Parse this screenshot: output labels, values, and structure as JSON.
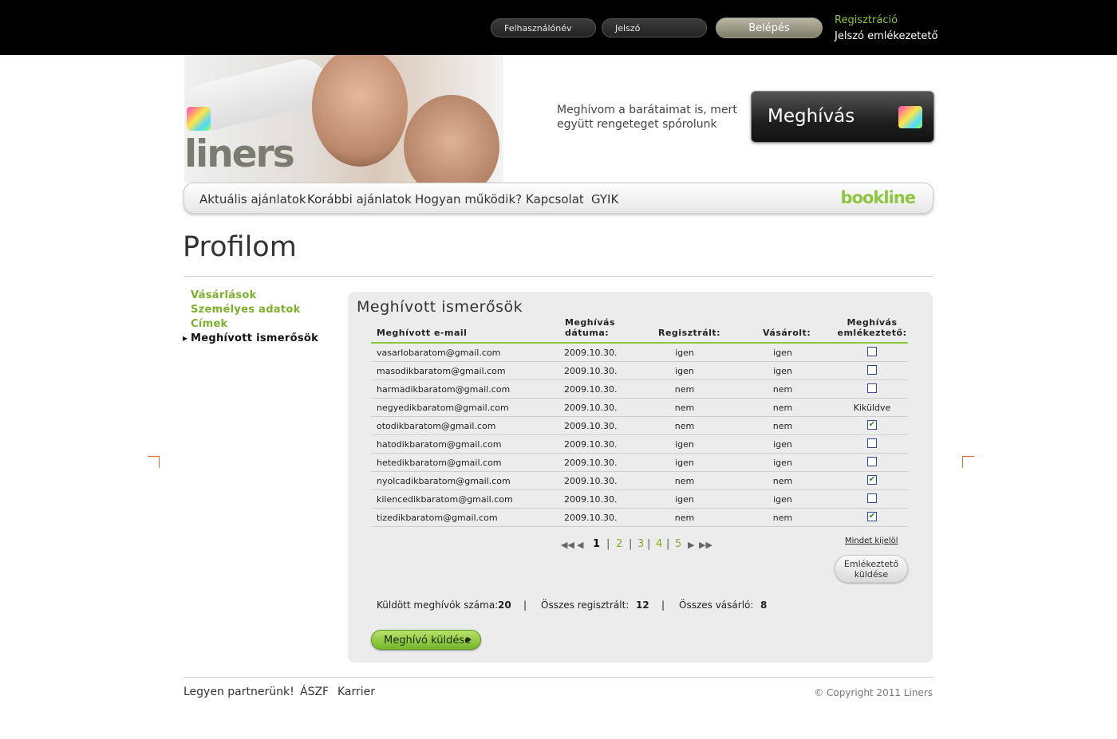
{
  "topbar": {
    "username_placeholder": "Felhasználónév",
    "password_placeholder": "Jelszó",
    "login_label": "Belépés",
    "register_label": "Regisztráció",
    "password_reminder_label": "Jelszó emlékezetető"
  },
  "header": {
    "logo_text": "liners",
    "slogan": "Meghívom a barátaimat is, mert együtt rengeteget spórolunk",
    "invite_label": "Meghívás"
  },
  "nav": {
    "items": [
      "Aktuális ajánlatok",
      "Korábbi ajánlatok",
      "Hogyan működik?",
      "Kapcsolat",
      "GYIK"
    ],
    "partner_logo": "bookline"
  },
  "page_title": "Profilom",
  "sidebar": {
    "items": [
      "Vásárlások",
      "Személyes adatok",
      "Címek",
      "Meghívott ismerősök"
    ],
    "active_index": 3
  },
  "panel": {
    "title": "Meghívott ismerősök",
    "headers": {
      "email": "Meghívott e-mail",
      "date": "Meghívás dátuma:",
      "registered": "Regisztrált:",
      "purchased": "Vásárolt:",
      "reminder": "Meghívás emlékeztető:"
    },
    "rows": [
      {
        "email": "vasarlobaratom@gmail.com",
        "date": "2009.10.30.",
        "registered": "igen",
        "purchased": "igen",
        "reminder": "unchecked"
      },
      {
        "email": "masodikbaratom@gmail.com",
        "date": "2009.10.30.",
        "registered": "igen",
        "purchased": "igen",
        "reminder": "unchecked"
      },
      {
        "email": "harmadikbaratom@gmail.com",
        "date": "2009.10.30.",
        "registered": "nem",
        "purchased": "nem",
        "reminder": "unchecked"
      },
      {
        "email": "negyedikbaratom@gmail.com",
        "date": "2009.10.30.",
        "registered": "nem",
        "purchased": "nem",
        "reminder": "Kiküldve"
      },
      {
        "email": "otodikbaratom@gmail.com",
        "date": "2009.10.30.",
        "registered": "nem",
        "purchased": "nem",
        "reminder": "checked"
      },
      {
        "email": "hatodikbaratom@gmail.com",
        "date": "2009.10.30.",
        "registered": "igen",
        "purchased": "igen",
        "reminder": "unchecked"
      },
      {
        "email": "hetedikbaratom@gmail.com",
        "date": "2009.10.30.",
        "registered": "igen",
        "purchased": "igen",
        "reminder": "unchecked"
      },
      {
        "email": "nyolcadikbaratom@gmail.com",
        "date": "2009.10.30.",
        "registered": "nem",
        "purchased": "nem",
        "reminder": "checked"
      },
      {
        "email": "kilencedikbaratom@gmail.com",
        "date": "2009.10.30.",
        "registered": "igen",
        "purchased": "igen",
        "reminder": "unchecked"
      },
      {
        "email": "tizedikbaratom@gmail.com",
        "date": "2009.10.30.",
        "registered": "nem",
        "purchased": "nem",
        "reminder": "checked"
      }
    ],
    "pager": {
      "current": "1",
      "pages": [
        "2",
        "3",
        "4",
        "5"
      ],
      "first_icon": "first-page-icon",
      "prev_icon": "prev-page-icon",
      "next_icon": "next-page-icon",
      "last_icon": "last-page-icon"
    },
    "select_all_label": "Mindet kijelöl",
    "send_reminder_label_1": "Emlékeztető",
    "send_reminder_label_2": "küldése",
    "stats": {
      "sent_label": "Küldött meghívók száma:",
      "sent_value": "20",
      "registered_label": "Összes regisztrált:",
      "registered_value": "12",
      "buyers_label": "Összes vásárló:",
      "buyers_value": "8"
    },
    "send_invite_label": "Meghívó küldése"
  },
  "footer": {
    "links": [
      "Legyen partnerünk!",
      "ÁSZF",
      "Karrier"
    ],
    "copyright": "© Copyright 2011 Liners"
  },
  "colors": {
    "accent_green": "#8dc63f",
    "topbar_bg": "#000000",
    "panel_bg": "#ececec"
  }
}
